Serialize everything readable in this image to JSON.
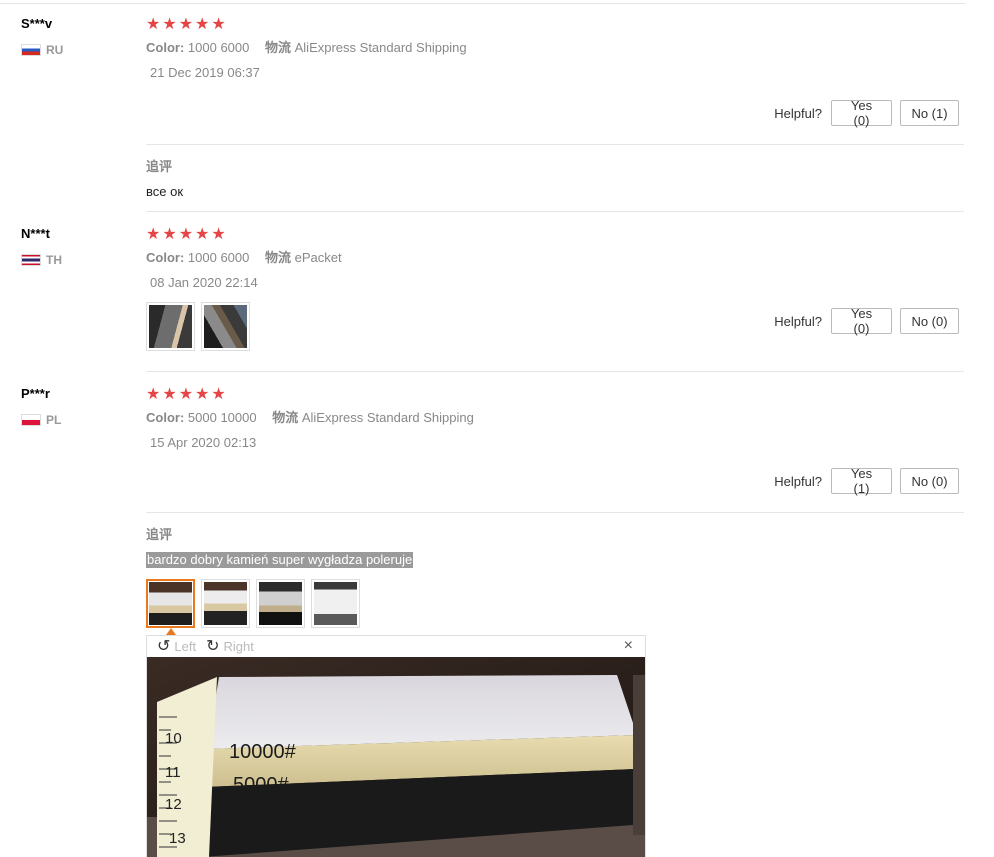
{
  "reviews": [
    {
      "user": "S***v",
      "country": "RU",
      "stars": 5,
      "color_key": "Color:",
      "color_val": "1000 6000",
      "ship_key": "物流",
      "ship_val": "AliExpress Standard Shipping",
      "date": "21 Dec 2019 06:37",
      "helpful_label": "Helpful?",
      "yes": "Yes (0)",
      "no": "No (1)",
      "followup_title": "追评",
      "followup_text": "все ок"
    },
    {
      "user": "N***t",
      "country": "TH",
      "stars": 5,
      "color_key": "Color:",
      "color_val": "1000 6000",
      "ship_key": "物流",
      "ship_val": "ePacket",
      "date": "08 Jan 2020 22:14",
      "helpful_label": "Helpful?",
      "yes": "Yes (0)",
      "no": "No (0)"
    },
    {
      "user": "P***r",
      "country": "PL",
      "stars": 5,
      "color_key": "Color:",
      "color_val": "5000 10000",
      "ship_key": "物流",
      "ship_val": "AliExpress Standard Shipping",
      "date": "15 Apr 2020 02:13",
      "helpful_label": "Helpful?",
      "yes": "Yes (1)",
      "no": "No (0)",
      "followup_title": "追评",
      "followup_text": "bardzo dobry kamień super wygładza poleruje"
    }
  ],
  "viewer": {
    "left_label": "Left",
    "right_label": "Right",
    "close": "×",
    "photo_labels": [
      "10000#",
      "5000#"
    ],
    "ruler_numbers": [
      "10",
      "11",
      "12",
      "13"
    ]
  },
  "colors": {
    "star": "#e64545",
    "active_thumb": "#e8791e"
  }
}
